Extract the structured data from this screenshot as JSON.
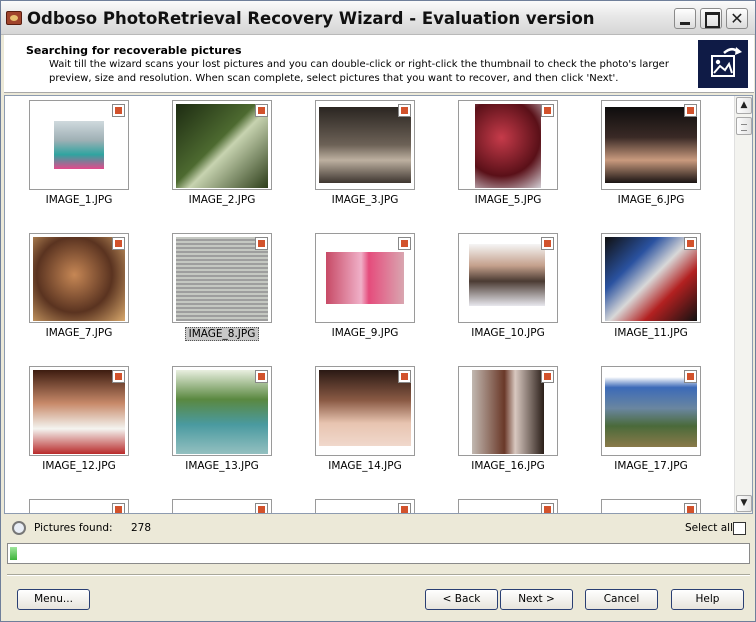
{
  "window": {
    "title": "Odboso PhotoRetrieval Recovery Wizard - Evaluation version",
    "close_glyph": "✕"
  },
  "header": {
    "title": "Searching for recoverable pictures",
    "description": "Wait till the wizard scans your lost pictures and you can double-click or right-click the thumbnail to check the photo's larger preview, size and resolution. When scan complete, select pictures that you want to recover, and then click 'Next'."
  },
  "pictures": [
    {
      "name": "IMAGE_1.JPG",
      "selected": false
    },
    {
      "name": "IMAGE_2.JPG",
      "selected": false
    },
    {
      "name": "IMAGE_3.JPG",
      "selected": false
    },
    {
      "name": "IMAGE_5.JPG",
      "selected": false
    },
    {
      "name": "IMAGE_6.JPG",
      "selected": false
    },
    {
      "name": "IMAGE_7.JPG",
      "selected": false
    },
    {
      "name": "IMAGE_8.JPG",
      "selected": true
    },
    {
      "name": "IMAGE_9.JPG",
      "selected": false
    },
    {
      "name": "IMAGE_10.JPG",
      "selected": false
    },
    {
      "name": "IMAGE_11.JPG",
      "selected": false
    },
    {
      "name": "IMAGE_12.JPG",
      "selected": false
    },
    {
      "name": "IMAGE_13.JPG",
      "selected": false
    },
    {
      "name": "IMAGE_14.JPG",
      "selected": false
    },
    {
      "name": "IMAGE_16.JPG",
      "selected": false
    },
    {
      "name": "IMAGE_17.JPG",
      "selected": false
    }
  ],
  "status": {
    "pictures_found_label": "Pictures found:",
    "pictures_found_value": "278",
    "select_all_label": "Select all",
    "select_all_checked": false
  },
  "scan_progress": 0.01,
  "buttons": {
    "menu": "Menu...",
    "back": "< Back",
    "next": "Next >",
    "cancel": "Cancel",
    "help": "Help"
  },
  "colors": {
    "logo_bg": "#0f1b46",
    "progress": "#3db33b",
    "selection": "#c8c8c8"
  }
}
